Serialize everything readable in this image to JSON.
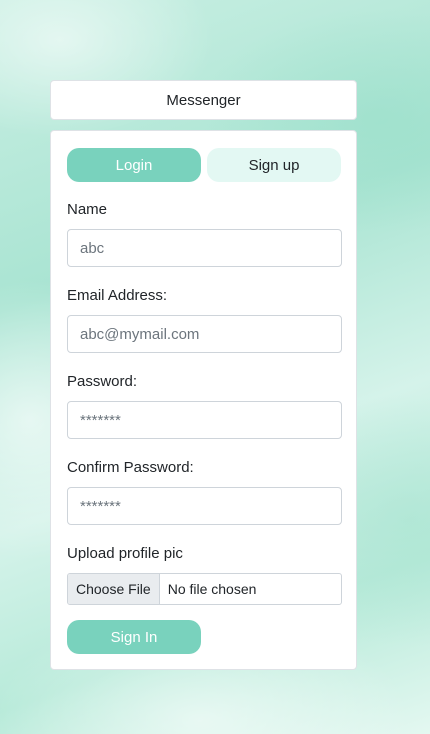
{
  "header": {
    "title": "Messenger"
  },
  "tabs": {
    "login": "Login",
    "signup": "Sign up"
  },
  "form": {
    "name": {
      "label": "Name",
      "placeholder": "abc"
    },
    "email": {
      "label": "Email Address:",
      "placeholder": "abc@mymail.com"
    },
    "password": {
      "label": "Password:",
      "placeholder": "*******"
    },
    "confirm_password": {
      "label": "Confirm Password:",
      "placeholder": "*******"
    },
    "profile_pic": {
      "label": "Upload profile pic",
      "button": "Choose File",
      "status": "No file chosen"
    },
    "submit_label": "Sign In"
  },
  "colors": {
    "accent": "#79d2bd",
    "accent_light": "#e3f8f3",
    "background": "#b7ead9"
  }
}
